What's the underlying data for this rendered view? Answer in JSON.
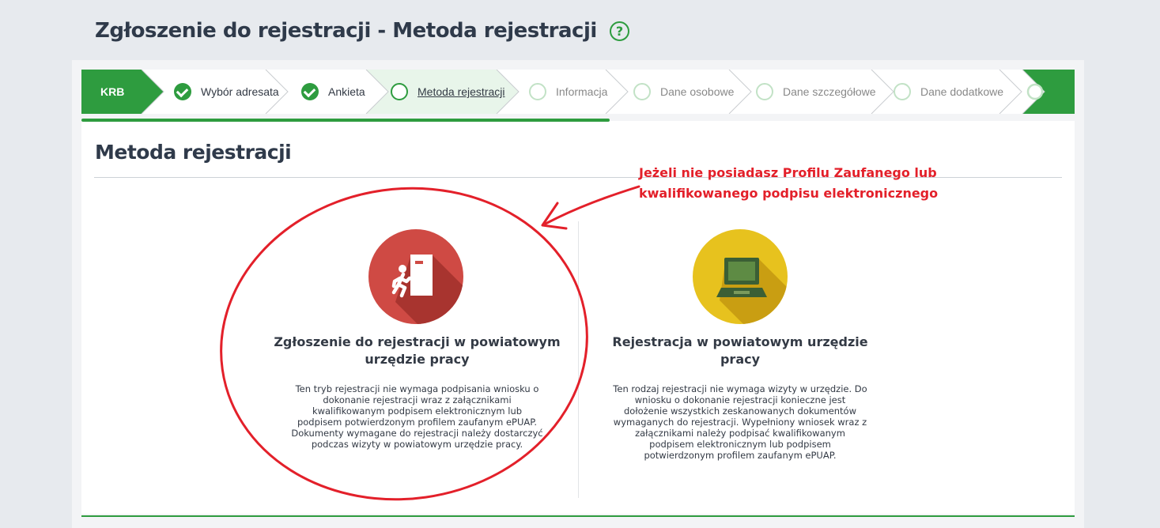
{
  "header": {
    "title": "Zgłoszenie do rejestracji - Metoda rejestracji",
    "help_symbol": "?"
  },
  "wizard": {
    "home_label": "KRB",
    "active_color": "#2e9c3f",
    "steps": [
      {
        "label": "Wybór adresata",
        "state": "done"
      },
      {
        "label": "Ankieta",
        "state": "done"
      },
      {
        "label": "Metoda rejestracji",
        "state": "current"
      },
      {
        "label": "Informacja",
        "state": "todo"
      },
      {
        "label": "Dane osobowe",
        "state": "todo"
      },
      {
        "label": "Dane szczegółowe",
        "state": "todo"
      },
      {
        "label": "Dane dodatkowe",
        "state": "todo"
      }
    ]
  },
  "section": {
    "title": "Metoda rejestracji"
  },
  "annotation": {
    "lines": [
      "Jeżeli nie posiadasz Profilu Zaufanego lub",
      "kwalifikowanego podpisu elektronicznego"
    ],
    "color": "#e3202a"
  },
  "options": [
    {
      "icon": "exit-door-person-icon",
      "icon_color": "#cf4a44",
      "title_lines": [
        "Zgłoszenie do rejestracji w powiatowym",
        "urzędzie pracy"
      ],
      "desc_lines": [
        "Ten tryb rejestracji nie wymaga podpisania wniosku o",
        "dokonanie rejestracji wraz z załącznikami",
        "kwalifikowanym podpisem elektronicznym lub",
        "podpisem potwierdzonym profilem zaufanym ePUAP.",
        "Dokumenty wymagane do rejestracji należy dostarczyć",
        "podczas wizyty w powiatowym urzędzie pracy."
      ]
    },
    {
      "icon": "laptop-icon",
      "icon_color": "#e7c21e",
      "title_lines": [
        "Rejestracja w powiatowym urzędzie",
        "pracy"
      ],
      "desc_lines": [
        "Ten rodzaj rejestracji nie wymaga wizyty w urzędzie. Do",
        "wniosku o dokonanie rejestracji konieczne jest",
        "dołożenie wszystkich zeskanowanych dokumentów",
        "wymaganych do rejestracji. Wypełniony wniosek wraz z",
        "załącznikami należy podpisać kwalifikowanym",
        "podpisem elektronicznym lub podpisem",
        "potwierdzonym profilem zaufanym ePUAP."
      ]
    }
  ]
}
